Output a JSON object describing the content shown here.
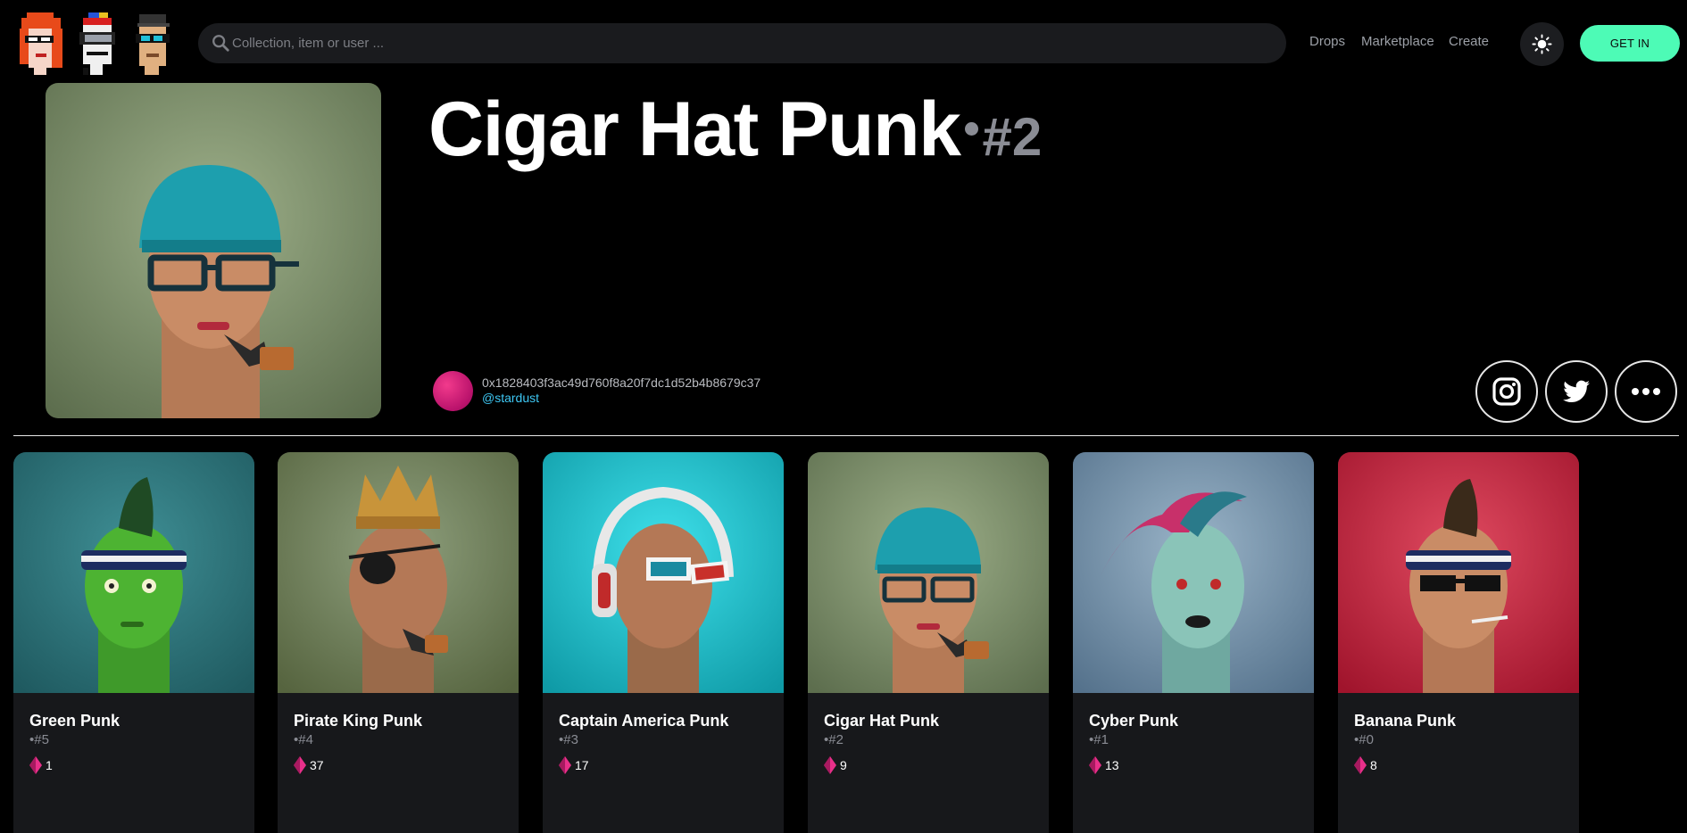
{
  "header": {
    "logo_icons": [
      "red-hair-punk-icon",
      "goggles-punk-icon",
      "cap-glasses-punk-icon"
    ],
    "search": {
      "placeholder": "Collection, item or user ...",
      "value": ""
    },
    "nav": [
      "Drops",
      "Marketplace",
      "Create"
    ],
    "theme_icon": "sun-icon",
    "get_in_label": "GET IN"
  },
  "item": {
    "name": "Cigar Hat Punk",
    "number": "#2",
    "owner_address": "0x1828403f3ac49d760f8a20f7dc1d52b4b8679c37",
    "owner_handle": "@stardust",
    "social": [
      "instagram-icon",
      "twitter-icon",
      "more-icon"
    ]
  },
  "cards": [
    {
      "name": "Green Punk",
      "id": "#5",
      "price": "1"
    },
    {
      "name": "Pirate King Punk",
      "id": "#4",
      "price": "37"
    },
    {
      "name": "Captain America Punk",
      "id": "#3",
      "price": "17"
    },
    {
      "name": "Cigar Hat Punk",
      "id": "#2",
      "price": "9"
    },
    {
      "name": "Cyber Punk",
      "id": "#1",
      "price": "13"
    },
    {
      "name": "Banana Punk",
      "id": "#0",
      "price": "8"
    }
  ],
  "colors": {
    "accent": "#4dfbb6",
    "handle": "#3ec8f4",
    "price_icon": "#e8308a",
    "card_bg": "#17181b"
  }
}
